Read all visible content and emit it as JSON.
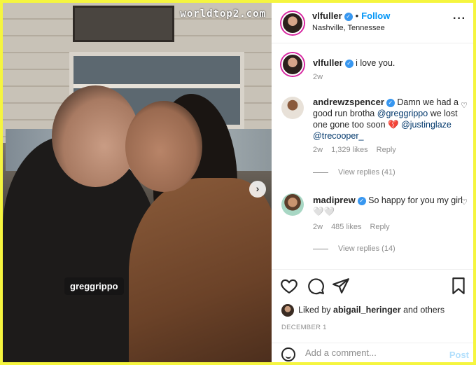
{
  "watermark": "worldtop2.com",
  "photo": {
    "tag_label": "greggrippo"
  },
  "post": {
    "username": "vlfuller",
    "follow_label": "Follow",
    "location": "Nashville, Tennessee",
    "caption": "i love you.",
    "caption_age": "2w",
    "liked_by_prefix": "Liked by",
    "liked_by_user": "abigail_heringer",
    "liked_by_suffix": "and others",
    "date": "DECEMBER 1",
    "add_comment_placeholder": "Add a comment...",
    "post_label": "Post"
  },
  "comments": [
    {
      "username": "andrewzspencer",
      "text_pre": "Damn we had a good run brotha",
      "mention1": "@greggrippo",
      "text_mid": "we lost one gone too soon 💔",
      "mention2": "@justinglaze",
      "mention3": "@trecooper_",
      "age": "2w",
      "likes": "1,329 likes",
      "reply": "Reply",
      "view_replies": "View replies (41)"
    },
    {
      "username": "madiprew",
      "text": "So happy for you my girl 🤍🤍",
      "age": "2w",
      "likes": "485 likes",
      "reply": "Reply",
      "view_replies": "View replies (14)"
    }
  ],
  "icons": [
    "verified-badge-icon",
    "more-options-icon",
    "like-heart-icon",
    "comment-icon",
    "share-icon",
    "save-bookmark-icon",
    "emoji-icon",
    "next-photo-icon"
  ],
  "colors": {
    "accent_link": "#0095f6",
    "verified": "#3897f0",
    "frame": "#f5f53f"
  }
}
